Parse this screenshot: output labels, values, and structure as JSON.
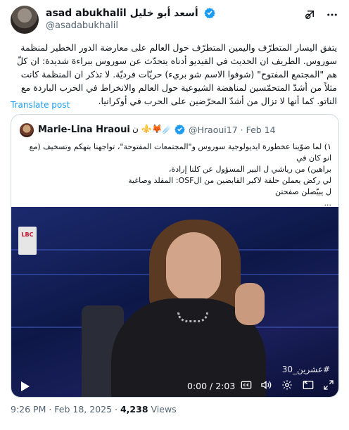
{
  "post": {
    "author_name": "asad abukhalil",
    "author_name_ar": "أسعد أبو خليل",
    "handle": "@asadabukhalil",
    "text": "يتفق اليسار المتطرّف واليمين المتطرّف حول العالم على معارضة الدور الخطير لمنظمة سوروس. الطريف ان الحديث في الفيديو أدناه يتحدّث عن سوروس ببراءة شديدة: ان كلّ هم \"المجتمع المفتوح\" (شوفوا الاسم شو بريء) حريّات فرديّة. لا تذكر ان المنظمة كانت مثلاً من أشدّ المتحمّسين لمناهضة الشيوعية حول العالم والانخراط في الحرب الباردة مع الناتو. كما أنها لا تزال من أشدّ المحرّضين على الحرب في أوكرانيا.",
    "translate_label": "Translate post",
    "timestamp": "9:26 PM · Feb 18, 2025",
    "separator": " · ",
    "views_count": "4,238",
    "views_label": "Views"
  },
  "quote": {
    "author_name": "Marie-Lina Hraoui",
    "emojis": "ن ⚜️🦊☄️",
    "handle_date": "@Hraoui17 · Feb 14",
    "lines": [
      "١) لما ضوّينا عخطورة ايديولوجية سوروس و\"المجتمعات المفتوحة\"، تواجهنا بتهكم وتسخيف (مع انو كان في",
      "براهين) من رياشي ل البير المسؤول عن كلنا إرادة،",
      "لي ركض يعملن حلقة لاكبر القابضين من الOSF: المقلد وصاغية",
      "ل يبيّضلن صفحتن",
      "..."
    ],
    "video": {
      "channel_logo": "LBC",
      "hashtag": "#عشرين_30",
      "time": "0:00 / 2:03"
    }
  },
  "icons": {
    "verified": "verified-badge-icon",
    "grok": "grok-icon",
    "more": "more-icon",
    "play": "play-icon",
    "cc": "captions-icon",
    "volume": "volume-icon",
    "settings": "settings-icon",
    "pip": "picture-in-picture-icon",
    "fullscreen": "fullscreen-icon"
  },
  "colors": {
    "accent": "#1d9bf0",
    "secondary_text": "#536471",
    "border": "#cfd9de"
  }
}
